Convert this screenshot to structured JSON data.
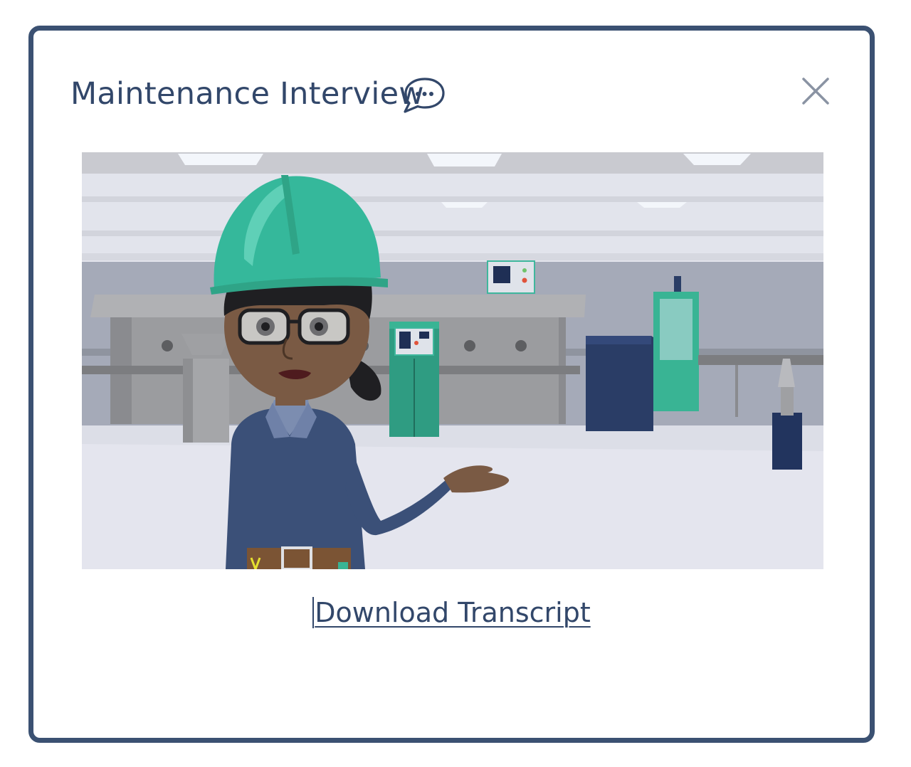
{
  "modal": {
    "title": "Maintenance Interview",
    "title_icon": "chat-bubble-ellipsis-icon",
    "close_icon": "close-icon",
    "video": {
      "content": "animated maintenance technician in factory"
    },
    "transcript_link": "Download Transcript"
  },
  "colors": {
    "border": "#3b5172",
    "title": "#32476a",
    "close": "#8a93a3",
    "helmet": "#35b89b",
    "shirt": "#3b5078"
  }
}
